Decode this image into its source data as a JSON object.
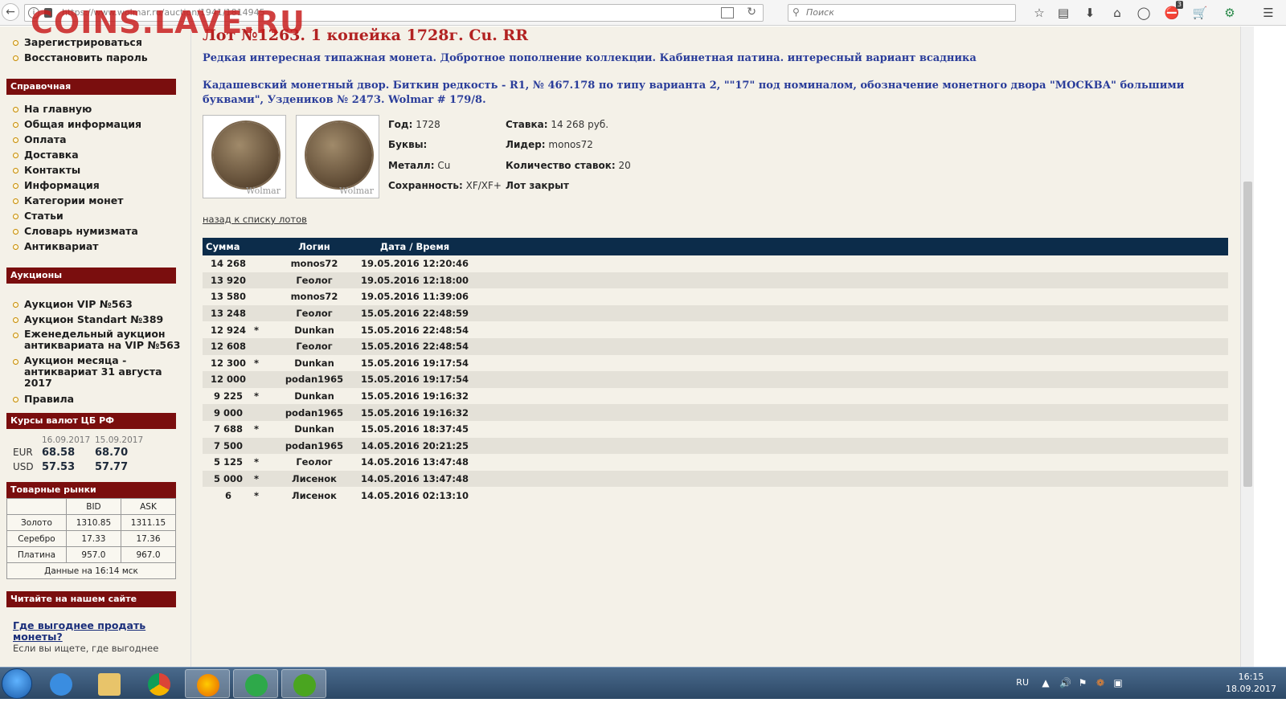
{
  "browser": {
    "url": "https://www.wolmar.ru/auction/1941/1814945",
    "search_placeholder": "Поиск",
    "badge_count": "3",
    "watermark": "COINS.LAVE.RU"
  },
  "sidebar": {
    "account_links": [
      "Зарегистрироваться",
      "Восстановить пароль"
    ],
    "ref_header": "Справочная",
    "ref_links": [
      "На главную",
      "Общая информация",
      "Оплата",
      "Доставка",
      "Контакты",
      "Информация",
      "Категории монет",
      "Статьи",
      "Словарь нумизмата",
      "Антиквариат"
    ],
    "auctions_header": "Аукционы",
    "auction_links": [
      "Аукцион VIP №563",
      "Аукцион Standart №389",
      "Еженедельный аукцион антиквариата на VIP №563",
      "Аукцион месяца - антиквариат 31 августа 2017",
      "Правила"
    ],
    "rates_header": "Курсы валют ЦБ РФ",
    "rates": {
      "date1": "16.09.2017",
      "date2": "15.09.2017",
      "rows": [
        {
          "cur": "EUR",
          "v1": "68.58",
          "v2": "68.70"
        },
        {
          "cur": "USD",
          "v1": "57.53",
          "v2": "57.77"
        }
      ]
    },
    "markets_header": "Товарные рынки",
    "markets": {
      "bid": "BID",
      "ask": "ASK",
      "rows": [
        {
          "name": "Золото",
          "bid": "1310.85",
          "ask": "1311.15"
        },
        {
          "name": "Серебро",
          "bid": "17.33",
          "ask": "17.36"
        },
        {
          "name": "Платина",
          "bid": "957.0",
          "ask": "967.0"
        }
      ],
      "footer": "Данные на 16:14 мск"
    },
    "read_header": "Читайте на нашем сайте",
    "read_link": "Где выгоднее продать монеты?",
    "read_text": "Если вы ищете, где выгоднее"
  },
  "lot": {
    "title": "Лот №1263. 1 копейка 1728г. Cu. RR",
    "desc1": "Редкая интересная типажная монета. Добротное пополнение коллекции. Кабинетная патина. интересный вариант всадника",
    "desc2": "Кадашевский монетный двор. Биткин редкость - R1, № 467.178  по типу варианта 2, \"\"17\" под номиналом, обозначение монетного двора \"МОСКВА\" большими буквами\", Уздеников № 2473. Wolmar # 179/8.",
    "watermark": "Wolmar",
    "year_label": "Год:",
    "year": "1728",
    "letters_label": "Буквы:",
    "letters": "",
    "metal_label": "Металл:",
    "metal": "Cu",
    "cond_label": "Сохранность:",
    "cond": "XF/XF+",
    "bid_label": "Ставка:",
    "bid": "14 268 руб.",
    "leader_label": "Лидер:",
    "leader": "monos72",
    "count_label": "Количество ставок:",
    "count": "20",
    "status": "Лот закрыт",
    "back_link": "назад к списку лотов"
  },
  "bids": {
    "headers": {
      "sum": "Сумма",
      "login": "Логин",
      "date": "Дата / Время"
    },
    "rows": [
      {
        "sum": "14 268",
        "star": "",
        "login": "monos72",
        "date": "19.05.2016 12:20:46"
      },
      {
        "sum": "13 920",
        "star": "",
        "login": "Геолог",
        "date": "19.05.2016 12:18:00"
      },
      {
        "sum": "13 580",
        "star": "",
        "login": "monos72",
        "date": "19.05.2016 11:39:06"
      },
      {
        "sum": "13 248",
        "star": "",
        "login": "Геолог",
        "date": "15.05.2016 22:48:59"
      },
      {
        "sum": "12 924",
        "star": "*",
        "login": "Dunkan",
        "date": "15.05.2016 22:48:54"
      },
      {
        "sum": "12 608",
        "star": "",
        "login": "Геолог",
        "date": "15.05.2016 22:48:54"
      },
      {
        "sum": "12 300",
        "star": "*",
        "login": "Dunkan",
        "date": "15.05.2016 19:17:54"
      },
      {
        "sum": "12 000",
        "star": "",
        "login": "podan1965",
        "date": "15.05.2016 19:17:54"
      },
      {
        "sum": "9 225",
        "star": "*",
        "login": "Dunkan",
        "date": "15.05.2016 19:16:32"
      },
      {
        "sum": "9 000",
        "star": "",
        "login": "podan1965",
        "date": "15.05.2016 19:16:32"
      },
      {
        "sum": "7 688",
        "star": "*",
        "login": "Dunkan",
        "date": "15.05.2016 18:37:45"
      },
      {
        "sum": "7 500",
        "star": "",
        "login": "podan1965",
        "date": "14.05.2016 20:21:25"
      },
      {
        "sum": "5 125",
        "star": "*",
        "login": "Геолог",
        "date": "14.05.2016 13:47:48"
      },
      {
        "sum": "5 000",
        "star": "*",
        "login": "Лисенок",
        "date": "14.05.2016 13:47:48"
      },
      {
        "sum": "6",
        "star": "*",
        "login": "Лисенок",
        "date": "14.05.2016 02:13:10"
      }
    ]
  },
  "taskbar": {
    "lang": "RU",
    "time": "16:15",
    "date": "18.09.2017"
  }
}
